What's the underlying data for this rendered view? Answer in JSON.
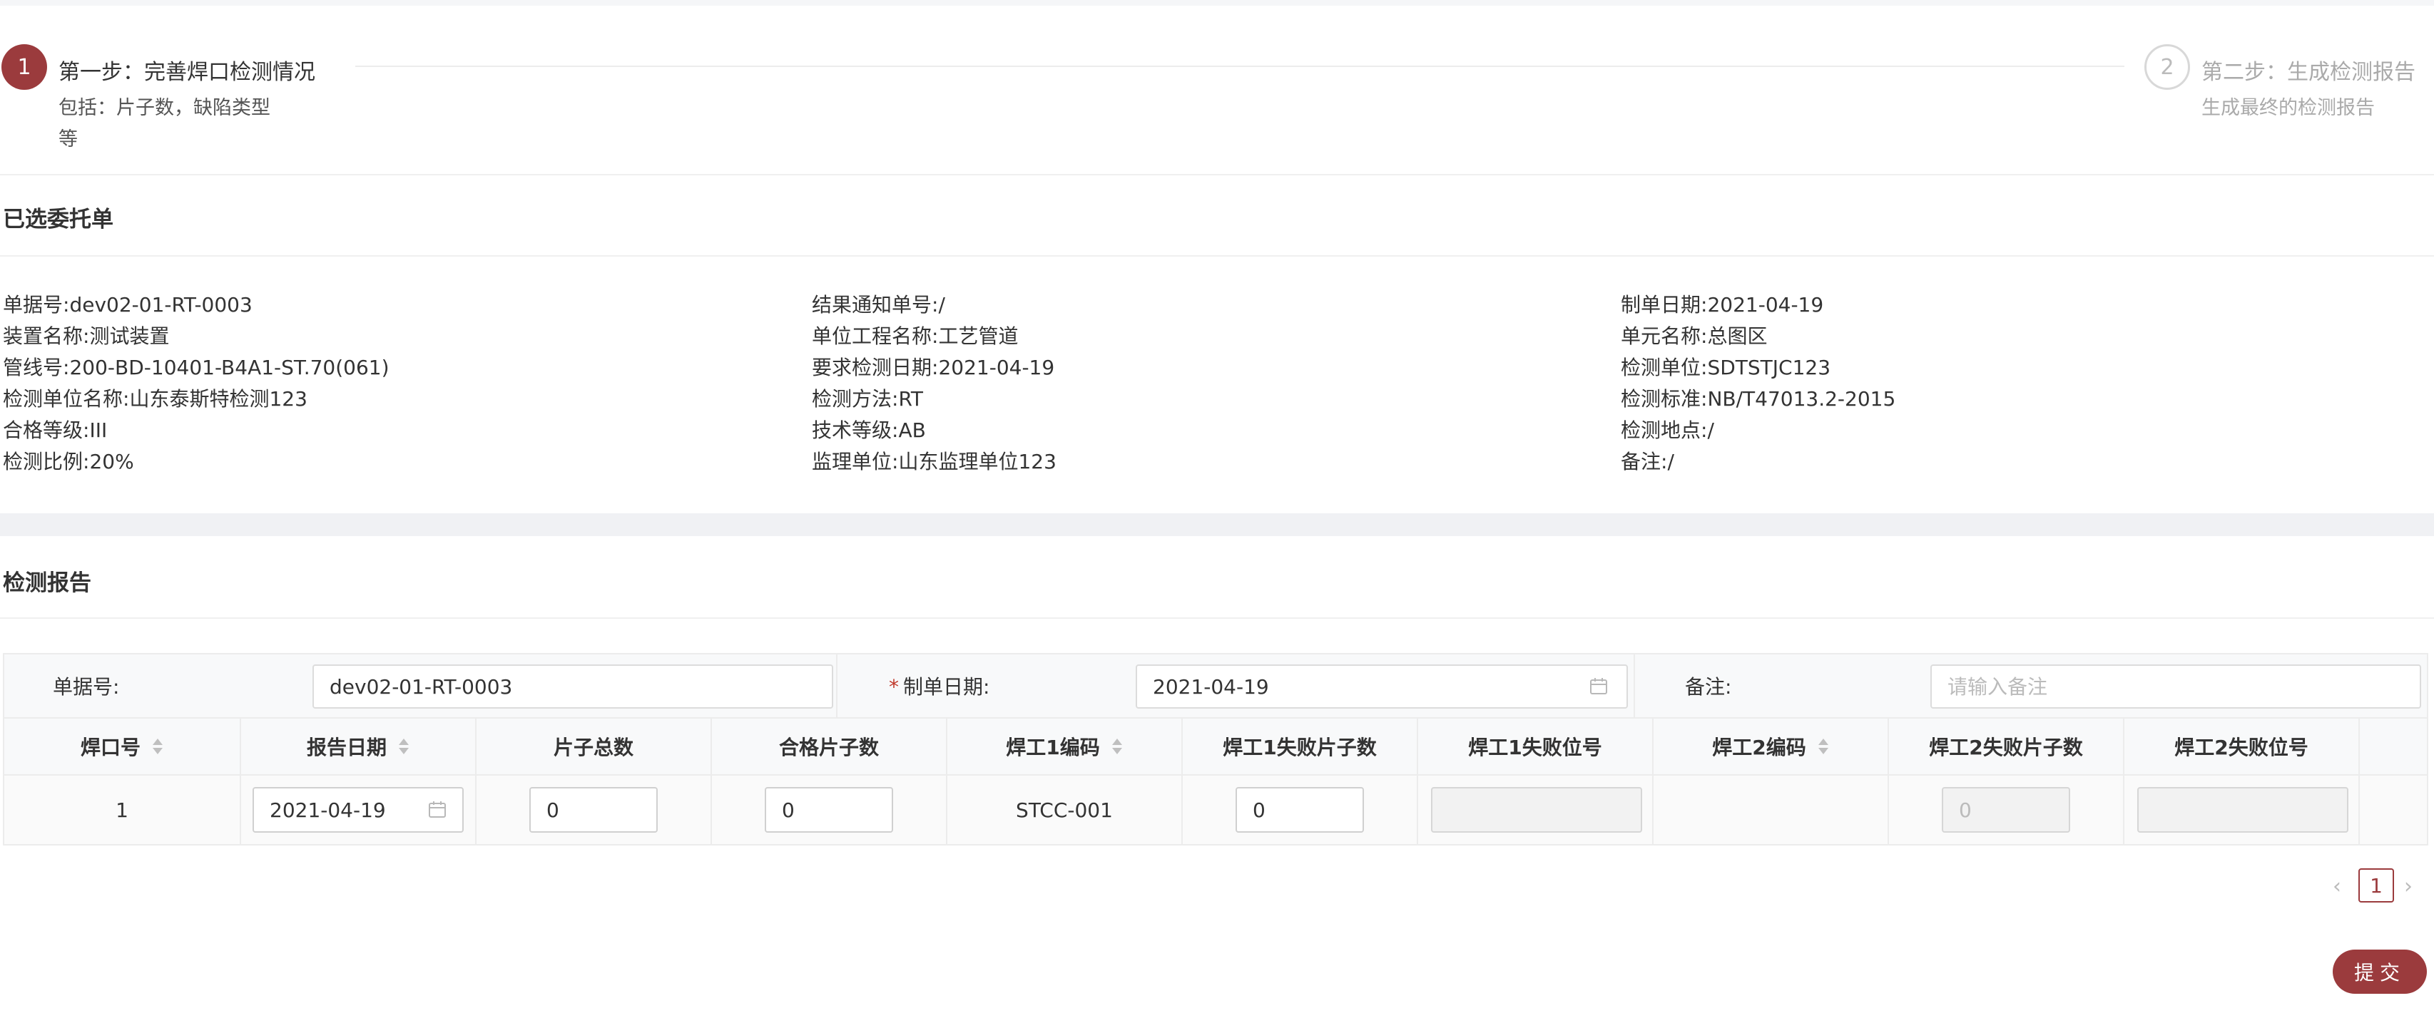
{
  "steps": [
    {
      "number": "1",
      "title": "第一步：完善焊口检测情况",
      "desc": "包括：片子数，缺陷类型等"
    },
    {
      "number": "2",
      "title": "第二步：生成检测报告",
      "desc": "生成最终的检测报告"
    }
  ],
  "selected_order": {
    "title": "已选委托单",
    "columns": [
      [
        {
          "k": "单据号",
          "v": "dev02-01-RT-0003"
        },
        {
          "k": "装置名称",
          "v": "测试装置"
        },
        {
          "k": "管线号",
          "v": "200-BD-10401-B4A1-ST.70(061)"
        },
        {
          "k": "检测单位名称",
          "v": "山东泰斯特检测123"
        },
        {
          "k": "合格等级",
          "v": "III"
        },
        {
          "k": "检测比例",
          "v": "20%"
        }
      ],
      [
        {
          "k": "结果通知单号",
          "v": "/"
        },
        {
          "k": "单位工程名称",
          "v": "工艺管道"
        },
        {
          "k": "要求检测日期",
          "v": "2021-04-19"
        },
        {
          "k": "检测方法",
          "v": "RT"
        },
        {
          "k": "技术等级",
          "v": "AB"
        },
        {
          "k": "监理单位",
          "v": "山东监理单位123"
        }
      ],
      [
        {
          "k": "制单日期",
          "v": "2021-04-19"
        },
        {
          "k": "单元名称",
          "v": "总图区"
        },
        {
          "k": "检测单位",
          "v": "SDTSTJC123"
        },
        {
          "k": "检测标准",
          "v": "NB/T47013.2-2015"
        },
        {
          "k": "检测地点",
          "v": "/"
        },
        {
          "k": "备注",
          "v": "/"
        }
      ]
    ],
    "separator": ":"
  },
  "report": {
    "title": "检测报告",
    "form": {
      "doc_no_label": "单据号:",
      "doc_no_value": "dev02-01-RT-0003",
      "required_mark": "*",
      "date_label": "制单日期:",
      "date_value": "2021-04-19",
      "remark_label": "备注:",
      "remark_placeholder": "请输入备注"
    },
    "table": {
      "headers": [
        "焊口号",
        "报告日期",
        "片子总数",
        "合格片子数",
        "焊工1编码",
        "焊工1失败片子数",
        "焊工1失败位号",
        "焊工2编码",
        "焊工2失败片子数",
        "焊工2失败位号"
      ],
      "rows": [
        {
          "weld_no": "1",
          "report_date": "2021-04-19",
          "film_total": "0",
          "qualified_films": "0",
          "welder1_code": "STCC-001",
          "welder1_failed": "0",
          "welder1_failed_pos": "",
          "welder2_code": "",
          "welder2_failed": "0",
          "welder2_failed_pos": ""
        }
      ]
    }
  },
  "pagination": {
    "prev": "‹",
    "current": "1",
    "next": "›"
  },
  "submit_label": "提交",
  "colors": {
    "primary": "#9b3b3d",
    "border": "#ececec",
    "band": "#f0f1f4"
  },
  "icons": [
    "calendar-icon",
    "sort-icon",
    "chevron-left-icon",
    "chevron-right-icon"
  ]
}
